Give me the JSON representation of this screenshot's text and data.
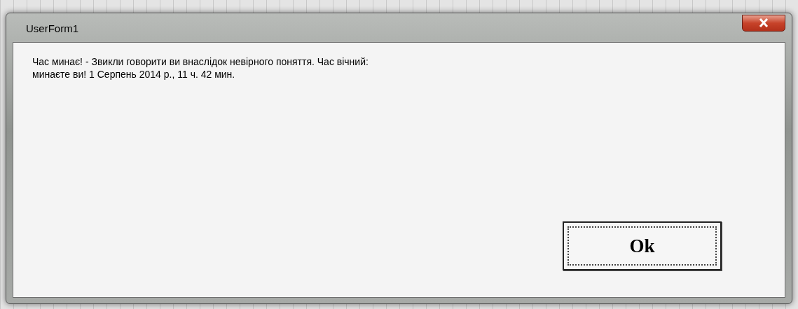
{
  "window": {
    "title": "UserForm1"
  },
  "message": [
    "Час минає! - Звикли говорити ви внаслідок невірного поняття. Час вічний:",
    "минаєте ви! 1 Серпень 2014 р., 11 ч. 42 мин."
  ],
  "buttons": [
    {
      "label": "Ok",
      "focused": true
    }
  ]
}
